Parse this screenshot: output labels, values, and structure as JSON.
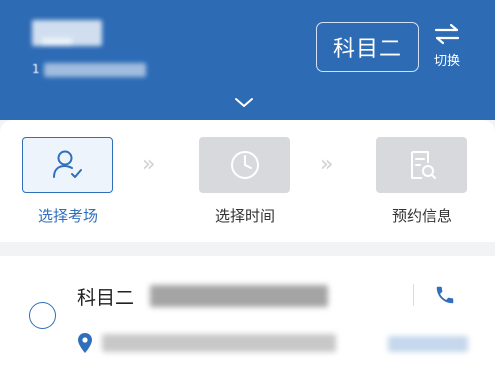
{
  "header": {
    "id_prefix": "1",
    "subject_label": "科目二",
    "switch_label": "切换",
    "chevron_icon": "chevron-down-icon",
    "background_color": "#2d6bb5"
  },
  "steps": [
    {
      "label": "选择考场",
      "icon": "person-check-icon",
      "active": true
    },
    {
      "label": "选择时间",
      "icon": "clock-icon",
      "active": false
    },
    {
      "label": "预约信息",
      "icon": "document-search-icon",
      "active": false
    }
  ],
  "step_separator": "»",
  "exam_site": {
    "name_prefix": "科目二",
    "phone_icon": "phone-icon",
    "location_icon": "location-pin-icon"
  },
  "colors": {
    "accent": "#2f6fbb",
    "inactive_step": "#d8d9dc"
  }
}
